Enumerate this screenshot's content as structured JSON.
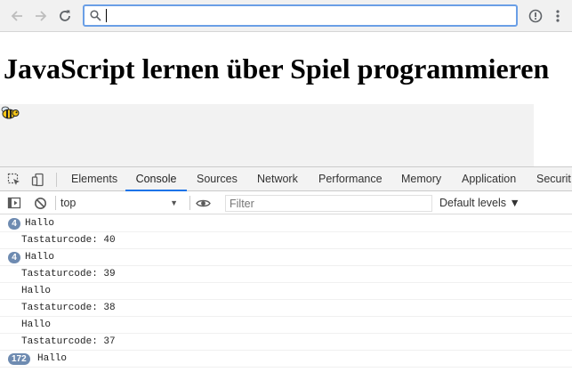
{
  "browser": {
    "address_value": "",
    "back_icon": "arrow-left",
    "forward_icon": "arrow-right",
    "reload_icon": "reload",
    "search_icon": "magnifier",
    "info_icon": "info-circle",
    "menu_icon": "three-dots-vertical"
  },
  "page": {
    "title": "JavaScript lernen über Spiel programmieren",
    "game_sprite": "bee"
  },
  "devtools": {
    "tabs": [
      "Elements",
      "Console",
      "Sources",
      "Network",
      "Performance",
      "Memory",
      "Application",
      "Securit"
    ],
    "active_tab": "Console",
    "context": "top",
    "filter_placeholder": "Filter",
    "levels_label": "Default levels ▼",
    "colors": {
      "accent": "#1a73e8",
      "badge": "#6e8bb1"
    }
  },
  "console": {
    "rows": [
      {
        "count": "4",
        "text": "Hallo"
      },
      {
        "count": "",
        "text": "Tastaturcode: 40"
      },
      {
        "count": "4",
        "text": "Hallo"
      },
      {
        "count": "",
        "text": "Tastaturcode: 39"
      },
      {
        "count": "",
        "text": "Hallo"
      },
      {
        "count": "",
        "text": "Tastaturcode: 38"
      },
      {
        "count": "",
        "text": "Hallo"
      },
      {
        "count": "",
        "text": "Tastaturcode: 37"
      },
      {
        "count": "172",
        "text": "Hallo"
      }
    ]
  }
}
